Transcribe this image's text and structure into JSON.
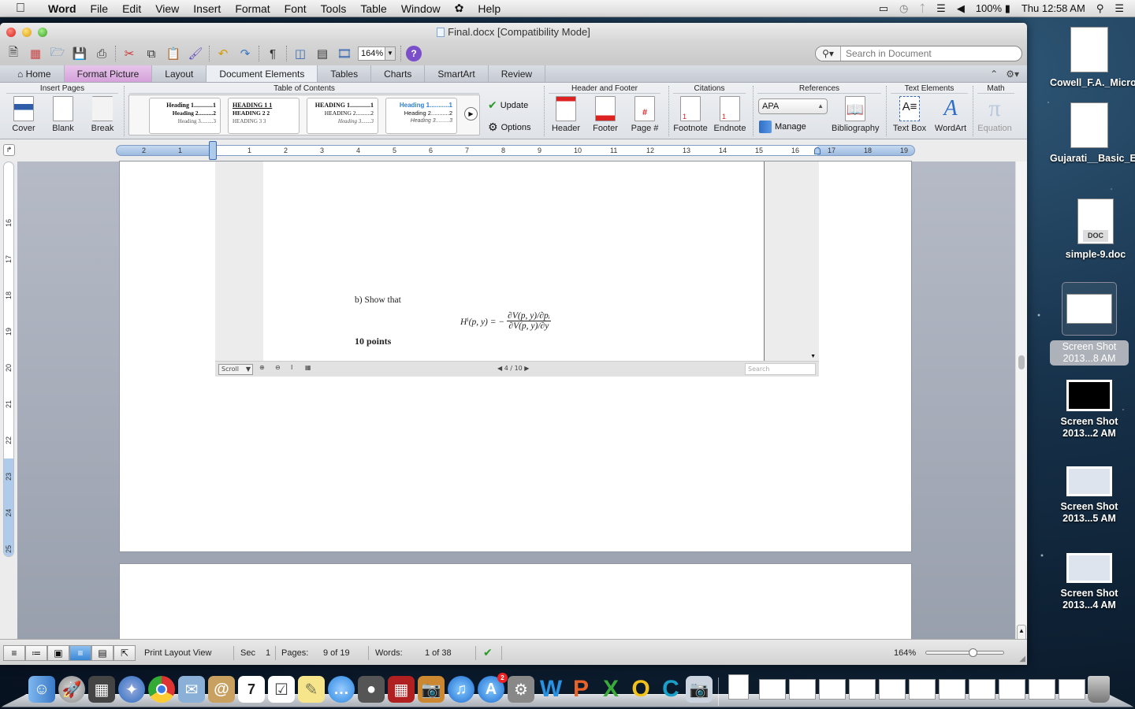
{
  "menubar": {
    "app": "Word",
    "items": [
      "File",
      "Edit",
      "View",
      "Insert",
      "Format",
      "Font",
      "Tools",
      "Table",
      "Window",
      "Help"
    ],
    "battery": "100%",
    "clock": "Thu 12:58 AM"
  },
  "window": {
    "title": "Final.docx [Compatibility Mode]",
    "zoom": "164%",
    "search_placeholder": "Search in Document"
  },
  "tabs": [
    "Home",
    "Format Picture",
    "Layout",
    "Document Elements",
    "Tables",
    "Charts",
    "SmartArt",
    "Review"
  ],
  "active_tab": "Document Elements",
  "ribbon": {
    "groups": {
      "insert_pages": "Insert Pages",
      "toc": "Table of Contents",
      "header_footer": "Header and Footer",
      "citations": "Citations",
      "references": "References",
      "text_elements": "Text Elements",
      "math": "Math"
    },
    "insert_pages": [
      "Cover",
      "Blank",
      "Break"
    ],
    "toc_styles": [
      {
        "h1": "Heading 1............1",
        "h2": "Heading 2..........2",
        "h3": "Heading 3.........3"
      },
      {
        "h1": "HEADING 1          1",
        "h2": "HEADING 2          2",
        "h3": "HEADING 3          3"
      },
      {
        "h1": "HEADING 1.............1",
        "h2": "HEADING 2..........2",
        "h3": "Heading 3.......3"
      },
      {
        "h1": "Heading 1...........1",
        "h2": "Heading 2...........2",
        "h3": "Heading 3.........3"
      }
    ],
    "toc_actions": [
      "Update",
      "Options"
    ],
    "header_footer": [
      "Header",
      "Footer",
      "Page #"
    ],
    "citations": [
      "Footnote",
      "Endnote"
    ],
    "style_select": "APA",
    "manage": "Manage",
    "bibliography": "Bibliography",
    "text_elements": [
      "Text Box",
      "WordArt"
    ],
    "math": [
      "Equation"
    ]
  },
  "ruler": {
    "h_numbers": [
      "2",
      "1",
      "1",
      "2",
      "3",
      "4",
      "5",
      "6",
      "7",
      "8",
      "9",
      "10",
      "11",
      "12",
      "13",
      "14",
      "15",
      "16",
      "17",
      "18",
      "19"
    ],
    "v_numbers": [
      "16",
      "17",
      "18",
      "19",
      "20",
      "21",
      "22",
      "23",
      "24",
      "25"
    ]
  },
  "document": {
    "embedded": {
      "prompt": "b) Show that",
      "equation_lhs": "Hⁱ(p, y) = −",
      "equation_num": "∂V(p, y)/∂pᵢ",
      "equation_den": "∂V(p, y)/∂y",
      "points": "10 points",
      "viewer_mode": "Scroll",
      "page_indicator": "4 / 10",
      "search_placeholder": "Search"
    }
  },
  "statusbar": {
    "view": "Print Layout View",
    "sec_label": "Sec",
    "sec_value": "1",
    "pages_label": "Pages:",
    "pages_value": "9 of 19",
    "words_label": "Words:",
    "words_value": "1 of 38",
    "zoom": "164%",
    "zoom_slider_fraction": 0.6
  },
  "desktop": {
    "icons": [
      {
        "label": "Cowell_F.A._Microec...s_.pdf"
      },
      {
        "label": "Gujarati__Basic_Eco...rg.pdf"
      },
      {
        "label": "simple-9.doc",
        "badge": "DOC"
      },
      {
        "label": "Screen Shot 2013...8 AM",
        "selected": true
      },
      {
        "label": "Screen Shot 2013...2 AM"
      },
      {
        "label": "Screen Shot 2013...5 AM"
      },
      {
        "label": "Screen Shot 2013...4 AM"
      }
    ]
  },
  "dock": {
    "apps": [
      "Finder",
      "Launchpad",
      "Mission Control",
      "Safari",
      "Chrome",
      "Mail",
      "Contacts",
      "Calendar",
      "Reminders",
      "Notes",
      "Messages",
      "FaceTime",
      "Photo Booth",
      "iPhoto",
      "iTunes",
      "App Store",
      "System Preferences",
      "Word",
      "PowerPoint",
      "Excel",
      "Outlook",
      "Communicator",
      "Preview"
    ],
    "calendar_day": "7",
    "appstore_badge": "2"
  }
}
